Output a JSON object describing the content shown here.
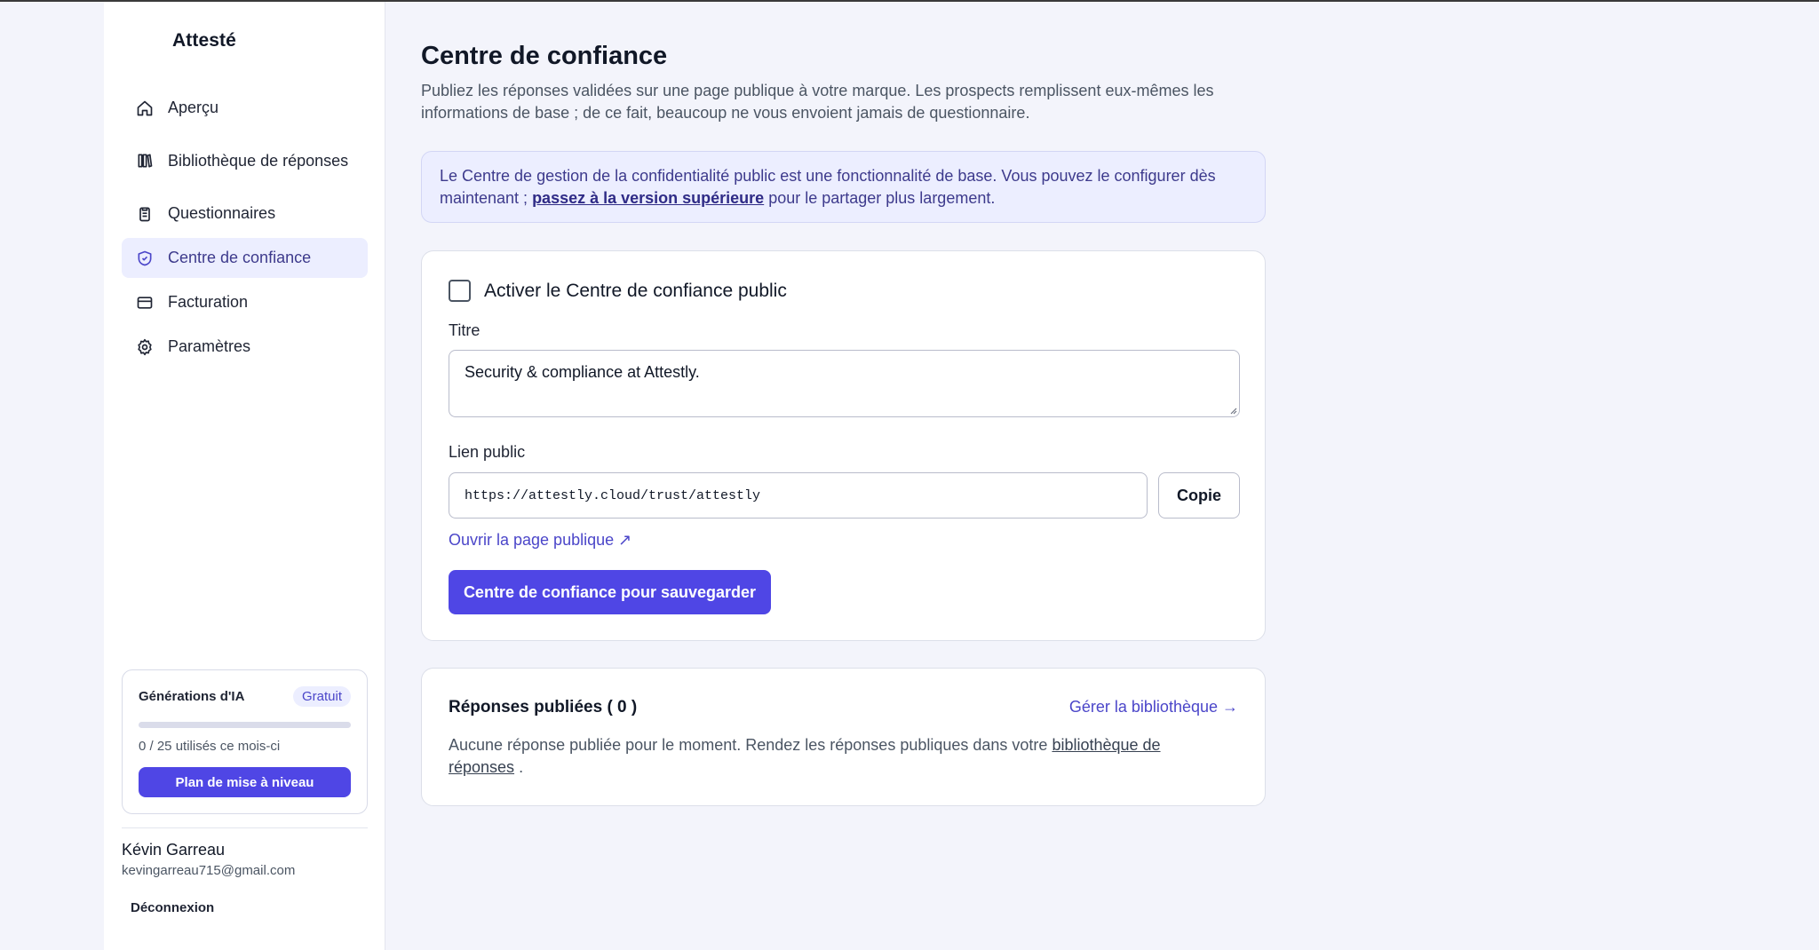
{
  "app": {
    "brand": "Attesté"
  },
  "sidebar": {
    "items": [
      {
        "label": "Aperçu",
        "icon": "home-icon"
      },
      {
        "label": "Bibliothèque de réponses",
        "icon": "library-icon"
      },
      {
        "label": "Questionnaires",
        "icon": "clipboard-icon"
      },
      {
        "label": "Centre de confiance",
        "icon": "shield-icon",
        "active": true
      },
      {
        "label": "Facturation",
        "icon": "credit-card-icon"
      },
      {
        "label": "Paramètres",
        "icon": "gear-icon"
      }
    ],
    "usage": {
      "title": "Générations d'IA",
      "plan_badge": "Gratuit",
      "used": 0,
      "limit": 25,
      "text": "0 / 25 utilisés ce mois-ci",
      "upgrade_label": "Plan de mise à niveau"
    },
    "user": {
      "name": "Kévin Garreau",
      "email": "kevingarreau715@gmail.com",
      "logout_label": "Déconnexion"
    }
  },
  "main": {
    "title": "Centre de confiance",
    "description": "Publiez les réponses validées sur une page publique à votre marque. Les prospects remplissent eux-mêmes les informations de base ; de ce fait, beaucoup ne vous envoient jamais de questionnaire.",
    "notice": {
      "text_before": "Le Centre de gestion de la confidentialité public est une fonctionnalité de base. Vous pouvez le configurer dès maintenant ; ",
      "link": "passez à la version supérieure",
      "text_after": " pour le partager plus largement."
    },
    "settings": {
      "enable_label": "Activer le Centre de confiance public",
      "enabled": false,
      "title_label": "Titre",
      "title_value": "Security & compliance at Attestly.",
      "link_label": "Lien public",
      "link_value": "https://attestly.cloud/trust/attestly",
      "copy_label": "Copie",
      "open_link_label": "Ouvrir la page publique ↗",
      "save_label": "Centre de confiance pour sauvegarder"
    },
    "published": {
      "title": "Réponses publiées ( 0 )",
      "manage_label": "Gérer la bibliothèque →",
      "empty_before": "Aucune réponse publiée pour le moment. Rendez les réponses publiques dans votre ",
      "empty_link": "bibliothèque de réponses",
      "empty_after": " ."
    }
  },
  "colors": {
    "accent": "#4f46e5",
    "accent_soft": "#eceeff",
    "background": "#f3f4fb",
    "text": "#111827",
    "muted": "#4b5563"
  }
}
